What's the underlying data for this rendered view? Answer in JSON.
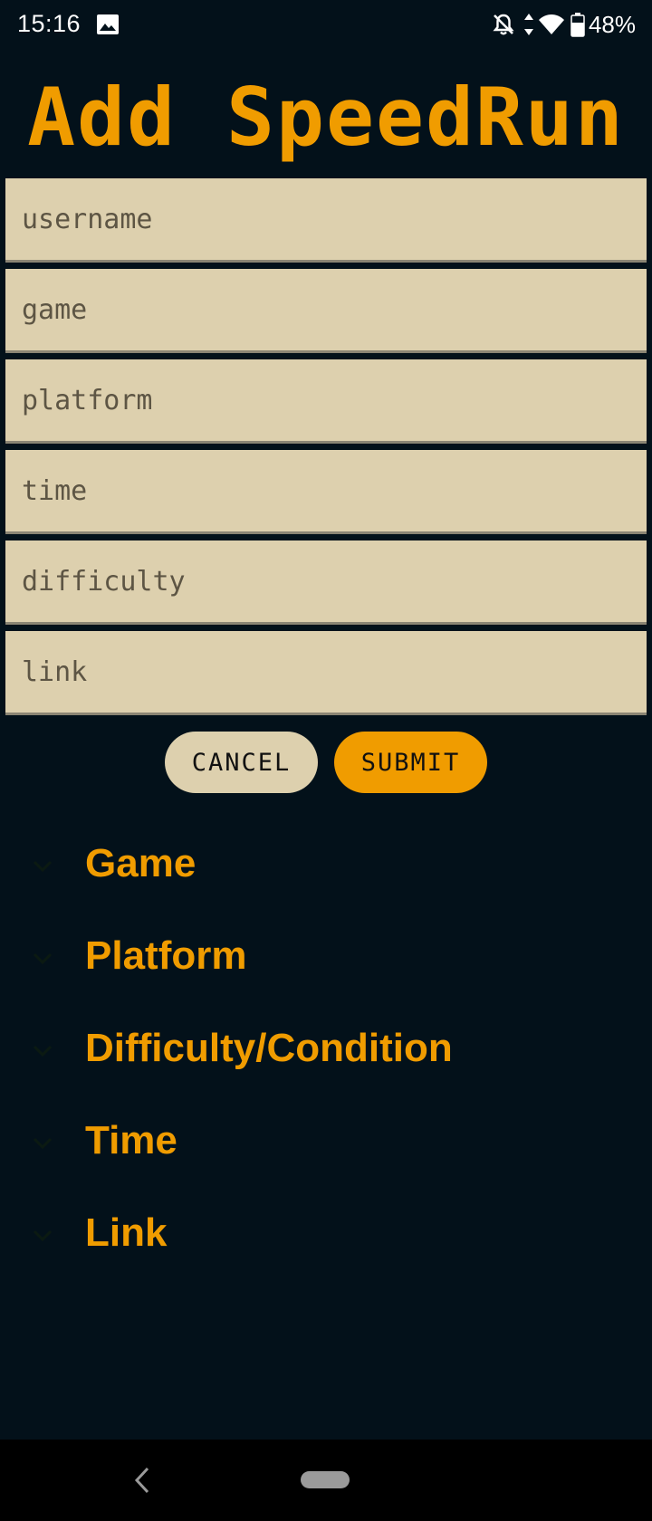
{
  "status_bar": {
    "time": "15:16",
    "battery": "48%",
    "icons": [
      "image-icon",
      "bell-off-icon",
      "data-arrows-icon",
      "wifi-icon",
      "battery-icon"
    ]
  },
  "title": "Add SpeedRun",
  "form": {
    "fields": [
      {
        "placeholder": "username",
        "value": ""
      },
      {
        "placeholder": "game",
        "value": ""
      },
      {
        "placeholder": "platform",
        "value": ""
      },
      {
        "placeholder": "time",
        "value": ""
      },
      {
        "placeholder": "difficulty",
        "value": ""
      },
      {
        "placeholder": "link",
        "value": ""
      }
    ]
  },
  "buttons": {
    "cancel": "CANCEL",
    "submit": "SUBMIT"
  },
  "sections": [
    {
      "label": "Game",
      "icon": "chevron-down-icon"
    },
    {
      "label": "Platform",
      "icon": "chevron-down-icon"
    },
    {
      "label": "Difficulty/Condition",
      "icon": "chevron-down-icon"
    },
    {
      "label": "Time",
      "icon": "chevron-down-icon"
    },
    {
      "label": "Link",
      "icon": "chevron-down-icon"
    }
  ],
  "nav": {
    "icons": [
      "back-icon",
      "home-pill-icon"
    ]
  },
  "colors": {
    "background": "#03111a",
    "accent": "#f09c00",
    "field_background": "#ddd0ae",
    "field_text": "#5d5544"
  }
}
